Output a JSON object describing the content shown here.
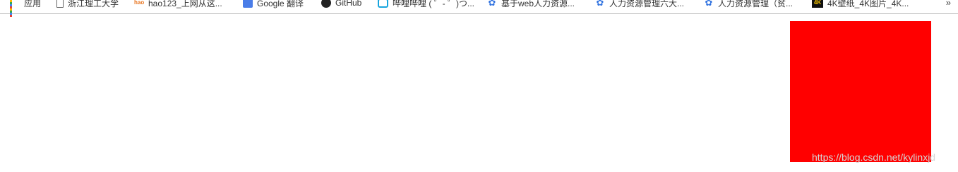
{
  "bookmarks_bar": {
    "items": [
      {
        "label": "应用",
        "icon": "apps-grid-icon"
      },
      {
        "label": "浙江理工大学",
        "icon": "page-icon"
      },
      {
        "label": "hao123_上网从这...",
        "icon": "hao123-icon"
      },
      {
        "label": "Google 翻译",
        "icon": "google-translate-icon"
      },
      {
        "label": "GitHub",
        "icon": "github-icon"
      },
      {
        "label": "哔哩哔哩 ( ゜- ゜)つ...",
        "icon": "bilibili-icon"
      },
      {
        "label": "基于web人力资源...",
        "icon": "baidu-paw-icon"
      },
      {
        "label": "人力资源管理六大...",
        "icon": "baidu-paw-icon"
      },
      {
        "label": "人力资源管理（贫...",
        "icon": "baidu-paw-icon"
      },
      {
        "label": "4K壁纸_4K图片_4K...",
        "icon": "4k-icon"
      }
    ],
    "overflow_glyph": "»"
  },
  "content": {
    "box_color": "#ff0000"
  },
  "watermark": {
    "text": "https://blog.csdn.net/kylinxjd"
  }
}
